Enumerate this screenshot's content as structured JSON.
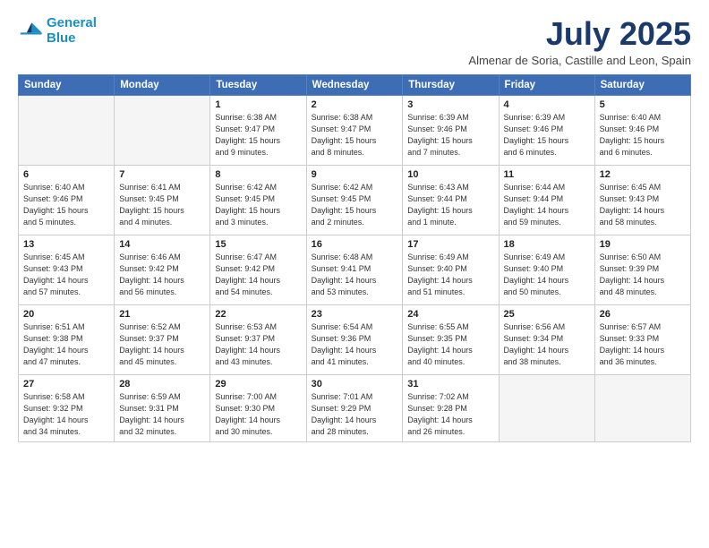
{
  "logo": {
    "line1": "General",
    "line2": "Blue"
  },
  "title": "July 2025",
  "location": "Almenar de Soria, Castille and Leon, Spain",
  "weekdays": [
    "Sunday",
    "Monday",
    "Tuesday",
    "Wednesday",
    "Thursday",
    "Friday",
    "Saturday"
  ],
  "weeks": [
    [
      {
        "day": "",
        "info": ""
      },
      {
        "day": "",
        "info": ""
      },
      {
        "day": "1",
        "info": "Sunrise: 6:38 AM\nSunset: 9:47 PM\nDaylight: 15 hours\nand 9 minutes."
      },
      {
        "day": "2",
        "info": "Sunrise: 6:38 AM\nSunset: 9:47 PM\nDaylight: 15 hours\nand 8 minutes."
      },
      {
        "day": "3",
        "info": "Sunrise: 6:39 AM\nSunset: 9:46 PM\nDaylight: 15 hours\nand 7 minutes."
      },
      {
        "day": "4",
        "info": "Sunrise: 6:39 AM\nSunset: 9:46 PM\nDaylight: 15 hours\nand 6 minutes."
      },
      {
        "day": "5",
        "info": "Sunrise: 6:40 AM\nSunset: 9:46 PM\nDaylight: 15 hours\nand 6 minutes."
      }
    ],
    [
      {
        "day": "6",
        "info": "Sunrise: 6:40 AM\nSunset: 9:46 PM\nDaylight: 15 hours\nand 5 minutes."
      },
      {
        "day": "7",
        "info": "Sunrise: 6:41 AM\nSunset: 9:45 PM\nDaylight: 15 hours\nand 4 minutes."
      },
      {
        "day": "8",
        "info": "Sunrise: 6:42 AM\nSunset: 9:45 PM\nDaylight: 15 hours\nand 3 minutes."
      },
      {
        "day": "9",
        "info": "Sunrise: 6:42 AM\nSunset: 9:45 PM\nDaylight: 15 hours\nand 2 minutes."
      },
      {
        "day": "10",
        "info": "Sunrise: 6:43 AM\nSunset: 9:44 PM\nDaylight: 15 hours\nand 1 minute."
      },
      {
        "day": "11",
        "info": "Sunrise: 6:44 AM\nSunset: 9:44 PM\nDaylight: 14 hours\nand 59 minutes."
      },
      {
        "day": "12",
        "info": "Sunrise: 6:45 AM\nSunset: 9:43 PM\nDaylight: 14 hours\nand 58 minutes."
      }
    ],
    [
      {
        "day": "13",
        "info": "Sunrise: 6:45 AM\nSunset: 9:43 PM\nDaylight: 14 hours\nand 57 minutes."
      },
      {
        "day": "14",
        "info": "Sunrise: 6:46 AM\nSunset: 9:42 PM\nDaylight: 14 hours\nand 56 minutes."
      },
      {
        "day": "15",
        "info": "Sunrise: 6:47 AM\nSunset: 9:42 PM\nDaylight: 14 hours\nand 54 minutes."
      },
      {
        "day": "16",
        "info": "Sunrise: 6:48 AM\nSunset: 9:41 PM\nDaylight: 14 hours\nand 53 minutes."
      },
      {
        "day": "17",
        "info": "Sunrise: 6:49 AM\nSunset: 9:40 PM\nDaylight: 14 hours\nand 51 minutes."
      },
      {
        "day": "18",
        "info": "Sunrise: 6:49 AM\nSunset: 9:40 PM\nDaylight: 14 hours\nand 50 minutes."
      },
      {
        "day": "19",
        "info": "Sunrise: 6:50 AM\nSunset: 9:39 PM\nDaylight: 14 hours\nand 48 minutes."
      }
    ],
    [
      {
        "day": "20",
        "info": "Sunrise: 6:51 AM\nSunset: 9:38 PM\nDaylight: 14 hours\nand 47 minutes."
      },
      {
        "day": "21",
        "info": "Sunrise: 6:52 AM\nSunset: 9:37 PM\nDaylight: 14 hours\nand 45 minutes."
      },
      {
        "day": "22",
        "info": "Sunrise: 6:53 AM\nSunset: 9:37 PM\nDaylight: 14 hours\nand 43 minutes."
      },
      {
        "day": "23",
        "info": "Sunrise: 6:54 AM\nSunset: 9:36 PM\nDaylight: 14 hours\nand 41 minutes."
      },
      {
        "day": "24",
        "info": "Sunrise: 6:55 AM\nSunset: 9:35 PM\nDaylight: 14 hours\nand 40 minutes."
      },
      {
        "day": "25",
        "info": "Sunrise: 6:56 AM\nSunset: 9:34 PM\nDaylight: 14 hours\nand 38 minutes."
      },
      {
        "day": "26",
        "info": "Sunrise: 6:57 AM\nSunset: 9:33 PM\nDaylight: 14 hours\nand 36 minutes."
      }
    ],
    [
      {
        "day": "27",
        "info": "Sunrise: 6:58 AM\nSunset: 9:32 PM\nDaylight: 14 hours\nand 34 minutes."
      },
      {
        "day": "28",
        "info": "Sunrise: 6:59 AM\nSunset: 9:31 PM\nDaylight: 14 hours\nand 32 minutes."
      },
      {
        "day": "29",
        "info": "Sunrise: 7:00 AM\nSunset: 9:30 PM\nDaylight: 14 hours\nand 30 minutes."
      },
      {
        "day": "30",
        "info": "Sunrise: 7:01 AM\nSunset: 9:29 PM\nDaylight: 14 hours\nand 28 minutes."
      },
      {
        "day": "31",
        "info": "Sunrise: 7:02 AM\nSunset: 9:28 PM\nDaylight: 14 hours\nand 26 minutes."
      },
      {
        "day": "",
        "info": ""
      },
      {
        "day": "",
        "info": ""
      }
    ]
  ]
}
